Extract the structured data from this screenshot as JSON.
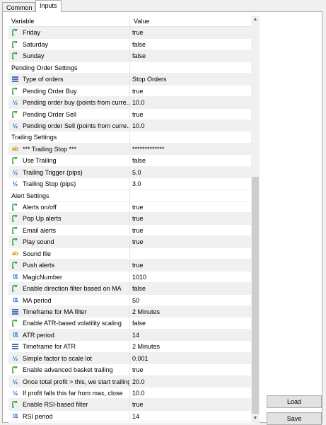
{
  "tabs": {
    "common": "Common",
    "inputs": "Inputs"
  },
  "grid": {
    "col_variable": "Variable",
    "col_value": "Value",
    "rows": [
      {
        "icon": "bool-icon",
        "label": "Friday",
        "value": "true"
      },
      {
        "icon": "bool-icon",
        "label": "Saturday",
        "value": "false"
      },
      {
        "icon": "bool-icon",
        "label": "Sunday",
        "value": "false"
      },
      {
        "icon": "",
        "label": "Pending Order Settings",
        "value": "",
        "group": true
      },
      {
        "icon": "enum-icon",
        "label": "Type of orders",
        "value": "Stop Orders"
      },
      {
        "icon": "bool-icon",
        "label": "Pending Order Buy",
        "value": "true"
      },
      {
        "icon": "double-icon",
        "label": "Pending order buy (points from curre...",
        "value": "10.0"
      },
      {
        "icon": "bool-icon",
        "label": "Pending Order Sell",
        "value": "true"
      },
      {
        "icon": "double-icon",
        "label": "Pending order Sell (points from curre...",
        "value": "10.0"
      },
      {
        "icon": "",
        "label": "Trailing Settings",
        "value": "",
        "group": true
      },
      {
        "icon": "string-icon",
        "label": "*** Trailing Stop ***",
        "value": "*************"
      },
      {
        "icon": "bool-icon",
        "label": "Use Trailing",
        "value": "false"
      },
      {
        "icon": "double-icon",
        "label": "Trailing Trigger (pips)",
        "value": "5.0"
      },
      {
        "icon": "double-icon",
        "label": "Trailing Stop (pips)",
        "value": "3.0"
      },
      {
        "icon": "",
        "label": "Alert Settings",
        "value": "",
        "group": true
      },
      {
        "icon": "bool-icon",
        "label": "Alerts on/off",
        "value": "true"
      },
      {
        "icon": "bool-icon",
        "label": "Pop Up alerts",
        "value": "true"
      },
      {
        "icon": "bool-icon",
        "label": "Email alerts",
        "value": "true"
      },
      {
        "icon": "bool-icon",
        "label": "Play sound",
        "value": "true"
      },
      {
        "icon": "string-icon",
        "label": "Sound file",
        "value": ""
      },
      {
        "icon": "bool-icon",
        "label": "Push alerts",
        "value": "true"
      },
      {
        "icon": "int-icon",
        "label": "MagicNumber",
        "value": "1010"
      },
      {
        "icon": "bool-icon",
        "label": "Enable direction filter based on MA",
        "value": "false"
      },
      {
        "icon": "int-icon",
        "label": "MA period",
        "value": "50"
      },
      {
        "icon": "enum-icon",
        "label": "Timeframe for MA filter",
        "value": "2 Minutes"
      },
      {
        "icon": "bool-icon",
        "label": "Enable ATR-based volatility scaling",
        "value": "false"
      },
      {
        "icon": "int-icon",
        "label": "ATR period",
        "value": "14"
      },
      {
        "icon": "enum-icon",
        "label": "Timeframe for ATR",
        "value": "2 Minutes"
      },
      {
        "icon": "double-icon",
        "label": "Simple factor to scale lot",
        "value": "0.001"
      },
      {
        "icon": "bool-icon",
        "label": "Enable advanced basket trailing",
        "value": "true"
      },
      {
        "icon": "double-icon",
        "label": "Once total profit > this, we start trailing",
        "value": "20.0"
      },
      {
        "icon": "double-icon",
        "label": "If profit falls this far from max, close",
        "value": "10.0"
      },
      {
        "icon": "bool-icon",
        "label": "Enable RSI-based filter",
        "value": "true"
      },
      {
        "icon": "int-icon",
        "label": "RSI period",
        "value": "14"
      }
    ]
  },
  "buttons": {
    "load": "Load",
    "save": "Save"
  },
  "colors": {
    "bool_icon": "#2e9a3e",
    "number_icon": "#1f6fd6",
    "string_icon": "#d48a00",
    "shade": "#f0f0f0"
  }
}
